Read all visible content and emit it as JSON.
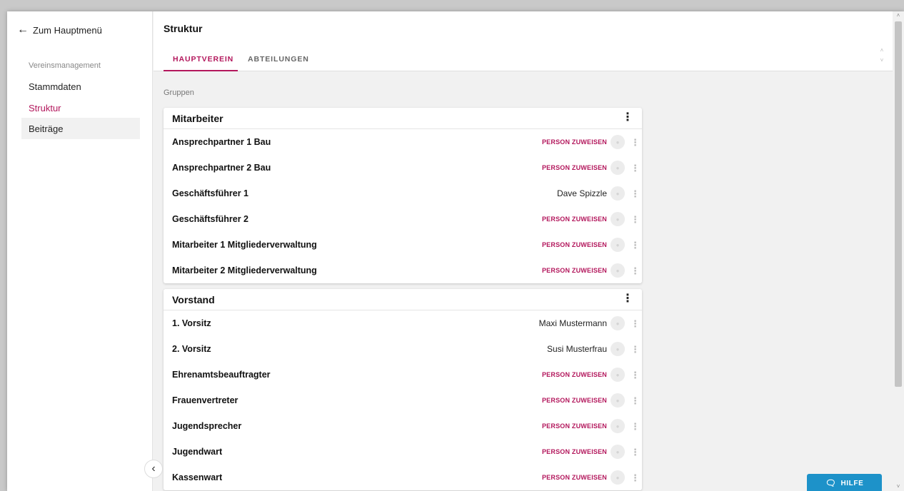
{
  "sidebar": {
    "back_label": "Zum Hauptmenü",
    "section_label": "Vereinsmanagement",
    "items": [
      {
        "label": "Stammdaten",
        "active": false
      },
      {
        "label": "Struktur",
        "active": true
      },
      {
        "label": "Beiträge",
        "active": false
      }
    ],
    "collapse_icon": "chevron-left-icon"
  },
  "header": {
    "title": "Struktur",
    "tabs": [
      {
        "label": "HAUPTVEREIN",
        "active": true
      },
      {
        "label": "ABTEILUNGEN",
        "active": false
      }
    ]
  },
  "main": {
    "groups_label": "Gruppen",
    "assign_label": "PERSON ZUWEISEN",
    "groups": [
      {
        "title": "Mitarbeiter",
        "rows": [
          {
            "label": "Ansprechpartner 1 Bau",
            "person": ""
          },
          {
            "label": "Ansprechpartner 2 Bau",
            "person": ""
          },
          {
            "label": "Geschäftsführer 1",
            "person": "Dave Spizzle"
          },
          {
            "label": "Geschäftsführer 2",
            "person": ""
          },
          {
            "label": "Mitarbeiter 1 Mitgliederverwaltung",
            "person": ""
          },
          {
            "label": "Mitarbeiter 2 Mitgliederverwaltung",
            "person": ""
          }
        ]
      },
      {
        "title": "Vorstand",
        "rows": [
          {
            "label": "1. Vorsitz",
            "person": "Maxi Mustermann"
          },
          {
            "label": "2. Vorsitz",
            "person": "Susi Musterfrau"
          },
          {
            "label": "Ehrenamtsbeauftragter",
            "person": ""
          },
          {
            "label": "Frauenvertreter",
            "person": ""
          },
          {
            "label": "Jugendsprecher",
            "person": ""
          },
          {
            "label": "Jugendwart",
            "person": ""
          },
          {
            "label": "Kassenwart",
            "person": ""
          }
        ]
      }
    ]
  },
  "help": {
    "label": "HILFE",
    "icon": "chat-bubble-icon"
  },
  "colors": {
    "accent": "#b3175c",
    "help": "#1d92c9"
  }
}
